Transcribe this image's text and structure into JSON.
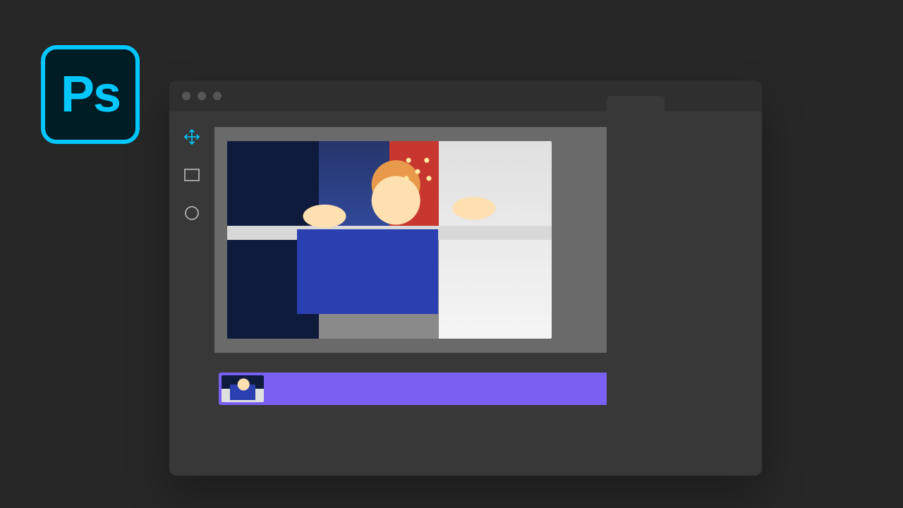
{
  "app": {
    "logo_text": "Ps",
    "brand_accent": "#00c8ff",
    "brand_bg": "#001d26"
  },
  "window": {
    "traffic_lights": [
      "dot",
      "dot",
      "dot"
    ]
  },
  "tools": {
    "move_icon": "move",
    "rectangle_icon": "rectangle",
    "ellipse_icon": "ellipse"
  },
  "canvas": {
    "has_image": true
  },
  "timeline": {
    "track_color": "#7a60f2",
    "clip_count": 1
  }
}
